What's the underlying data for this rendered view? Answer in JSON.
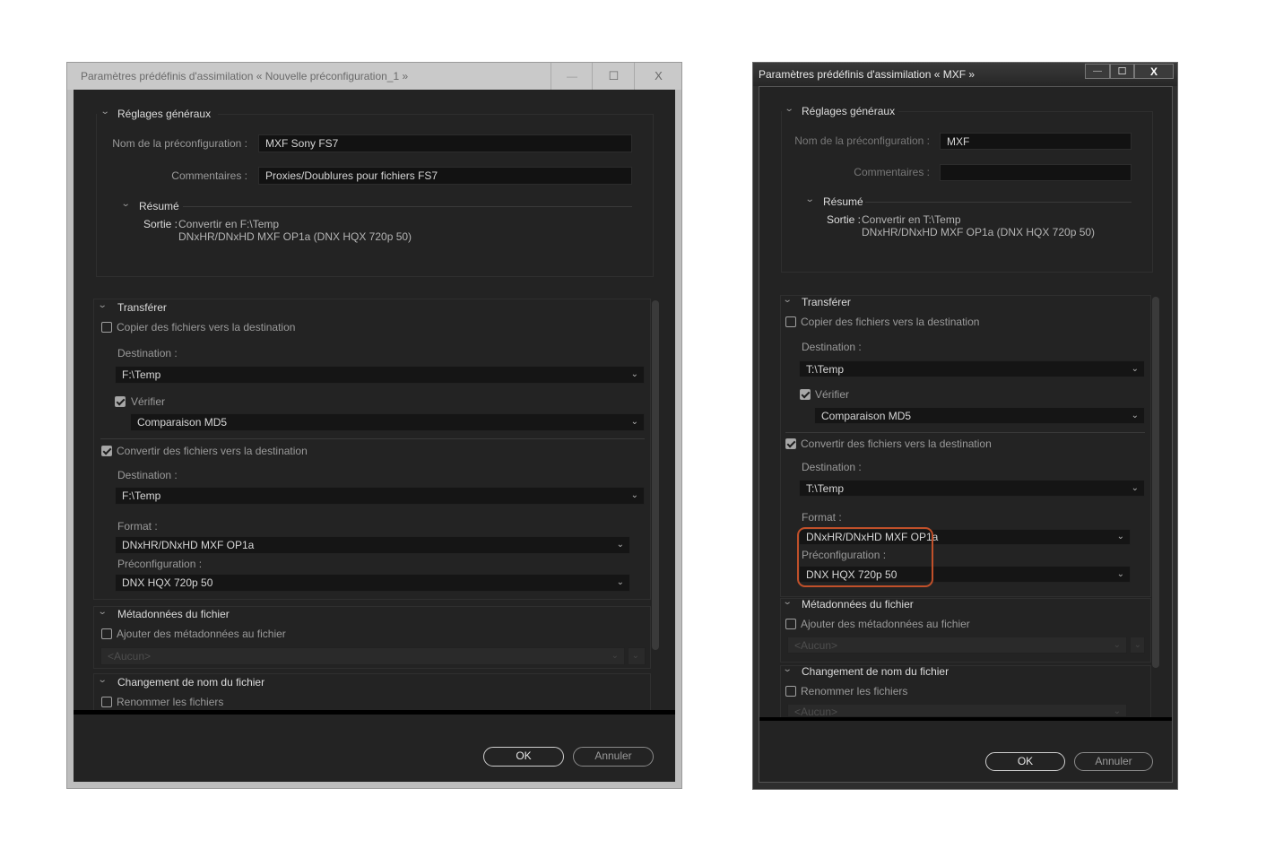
{
  "left": {
    "title": "Paramètres prédéfinis d'assimilation « Nouvelle préconfiguration_1 »",
    "window_buttons": {
      "minimize": "—",
      "maximize": "☐",
      "close": "X"
    },
    "general": {
      "header": "Réglages généraux",
      "name_label": "Nom de la préconfiguration :",
      "name_value": "MXF Sony FS7",
      "comments_label": "Commentaires :",
      "comments_value": "Proxies/Doublures pour fichiers FS7",
      "summary_header": "Résumé",
      "output_label": "Sortie :",
      "output_line1": "Convertir en F:\\Temp",
      "output_line2": "DNxHR/DNxHD MXF OP1a (DNX HQX 720p 50)"
    },
    "transfer": {
      "header": "Transférer",
      "copy_label": "Copier des fichiers vers la destination",
      "copy_checked": false,
      "destination_label": "Destination :",
      "destination_value": "F:\\Temp",
      "verify_label": "Vérifier",
      "verify_checked": true,
      "verify_value": "Comparaison MD5",
      "convert_label": "Convertir des fichiers vers la destination",
      "convert_checked": true,
      "destination2_label": "Destination :",
      "destination2_value": "F:\\Temp",
      "format_label": "Format :",
      "format_value": "DNxHR/DNxHD MXF OP1a",
      "preset_label": "Préconfiguration :",
      "preset_value": "DNX HQX 720p 50"
    },
    "metadata": {
      "header": "Métadonnées du fichier",
      "add_label": "Ajouter des métadonnées au fichier",
      "none_value": "<Aucun>"
    },
    "rename": {
      "header": "Changement de nom du fichier",
      "rename_label": "Renommer les fichiers"
    },
    "ok": "OK",
    "cancel": "Annuler"
  },
  "right": {
    "title": "Paramètres prédéfinis d'assimilation « MXF »",
    "window_buttons": {
      "minimize": "—",
      "maximize": "☐",
      "close": "X"
    },
    "general": {
      "header": "Réglages généraux",
      "name_label": "Nom de la préconfiguration :",
      "name_value": "MXF",
      "comments_label": "Commentaires :",
      "comments_value": "",
      "summary_header": "Résumé",
      "output_label": "Sortie :",
      "output_line1": "Convertir en T:\\Temp",
      "output_line2": "DNxHR/DNxHD MXF OP1a (DNX HQX 720p 50)"
    },
    "transfer": {
      "header": "Transférer",
      "copy_label": "Copier des fichiers vers la destination",
      "copy_checked": false,
      "destination_label": "Destination :",
      "destination_value": "T:\\Temp",
      "verify_label": "Vérifier",
      "verify_checked": true,
      "verify_value": "Comparaison MD5",
      "convert_label": "Convertir des fichiers vers la destination",
      "convert_checked": true,
      "destination2_label": "Destination :",
      "destination2_value": "T:\\Temp",
      "format_label": "Format :",
      "format_value": "DNxHR/DNxHD MXF OP1a",
      "preset_label": "Préconfiguration :",
      "preset_value": "DNX HQX 720p 50"
    },
    "metadata": {
      "header": "Métadonnées du fichier",
      "add_label": "Ajouter des métadonnées au fichier",
      "none_value": "<Aucun>"
    },
    "rename": {
      "header": "Changement de nom du fichier",
      "rename_label": "Renommer les fichiers",
      "none_value": "<Aucun>"
    },
    "ok": "OK",
    "cancel": "Annuler",
    "highlight_color": "#c0502a"
  }
}
